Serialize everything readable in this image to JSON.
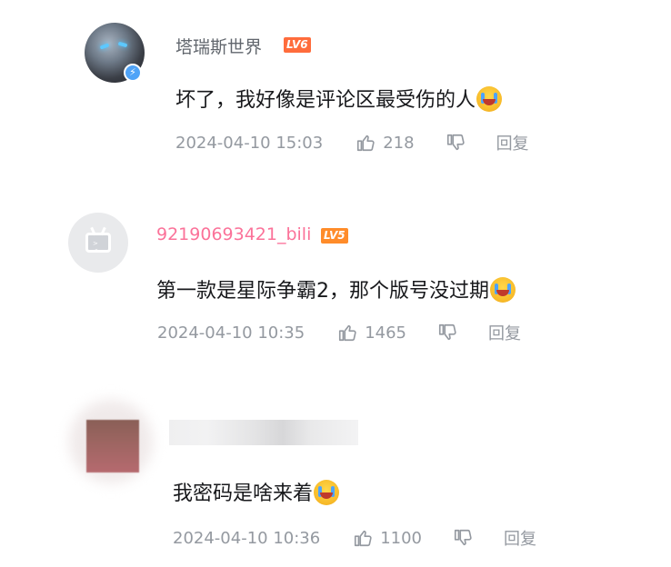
{
  "comments": [
    {
      "username": "塔瑞斯世界",
      "level": "LV6",
      "text": "坏了，我好像是评论区最受伤的人",
      "emoji": "crying-face-emoji",
      "date": "2024-04-10 15:03",
      "likes": "218",
      "reply_label": "回复",
      "verified": true
    },
    {
      "username": "92190693421_bili",
      "level": "LV5",
      "text": "第一款是星际争霸2，那个版号没过期",
      "emoji": "laughing-crying-face-emoji",
      "date": "2024-04-10 10:35",
      "likes": "1465",
      "reply_label": "回复"
    },
    {
      "username": "",
      "text": "我密码是啥来着",
      "emoji": "laughing-crying-face-emoji",
      "date": "2024-04-10 10:36",
      "likes": "1100",
      "reply_label": "回复"
    }
  ],
  "colors": {
    "vip_name": "#fb7299",
    "normal_name": "#61666d",
    "meta_gray": "#9499a0",
    "lv6": "#ff6c3c",
    "lv5": "#ff8c2a"
  }
}
